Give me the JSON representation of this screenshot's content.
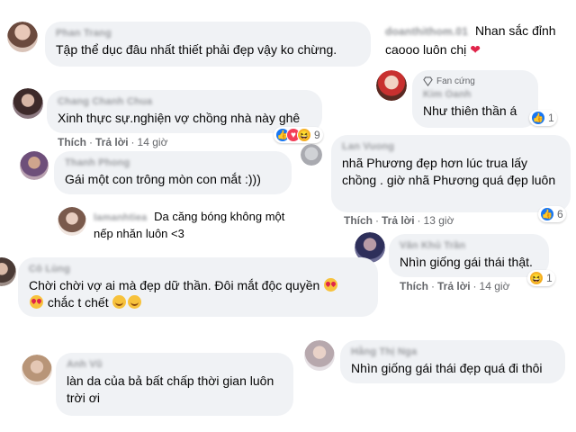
{
  "comments": [
    {
      "id": "c1",
      "author": "Phan Trang",
      "text": "Tập thể dục đâu nhất thiết phải đẹp vậy ko chừng."
    },
    {
      "id": "c2",
      "author": "doanthithom.01",
      "text_part1": "Nhan sắc đỉnh",
      "text_part2": "caooo luôn chị",
      "emoji": "❤️"
    },
    {
      "id": "c3",
      "badge": "Fan cứng",
      "author": "Kim Oanh",
      "text": "Như thiên thần á",
      "reactions": {
        "count": "1"
      }
    },
    {
      "id": "c4",
      "author": "Chang Chanh Chua",
      "text": "Xinh thực sự.nghiện vợ chồng nhà này ghê",
      "meta": {
        "like": "Thích",
        "reply": "Trả lời",
        "time": "14 giờ"
      },
      "reactions": {
        "count": "9"
      }
    },
    {
      "id": "c5",
      "author": "Thanh Phong",
      "text": "Gái một con trông mòn con mắt :)))"
    },
    {
      "id": "c6",
      "author": "Lan Vuong",
      "text": "nhã Phương đẹp hơn lúc trua lấy chồng . giờ nhã Phương quá đẹp luôn",
      "meta": {
        "like": "Thích",
        "reply": "Trả lời",
        "time": "13 giờ"
      },
      "reactions": {
        "count": "6"
      }
    },
    {
      "id": "c7",
      "author": "lamanhtiea",
      "text": "Da căng bóng không một nếp nhăn luôn <3"
    },
    {
      "id": "c8",
      "author": "Văn Khủ Trần",
      "text": "Nhìn giống gái thái thật.",
      "meta": {
        "like": "Thích",
        "reply": "Trả lời",
        "time": "14 giờ"
      },
      "reactions": {
        "count": "1"
      }
    },
    {
      "id": "c9",
      "author": "Cô Lùng",
      "text_line1": "Chời chời vợ ai mà đẹp dữ thần. Đôi mắt độc quyền",
      "text_line2": "chắc t chết"
    },
    {
      "id": "c10",
      "author": "Hằng Thị Nga",
      "text": "Nhìn giống gái thái đẹp quá đi thôi"
    },
    {
      "id": "c11",
      "author": "Anh Vũ",
      "text": "làn da của bả bất chấp thời gian luôn trời ơi"
    }
  ],
  "icons": {
    "like": "thumbs-up-icon",
    "haha": "haha-icon",
    "love": "love-icon",
    "heart_eyes": "heart-eyes-emoji",
    "grin": "grin-emoji",
    "fan_badge": "diamond-icon"
  },
  "colors": {
    "bubble": "#f0f2f5",
    "like": "#1877f2",
    "meta": "#65676b"
  }
}
